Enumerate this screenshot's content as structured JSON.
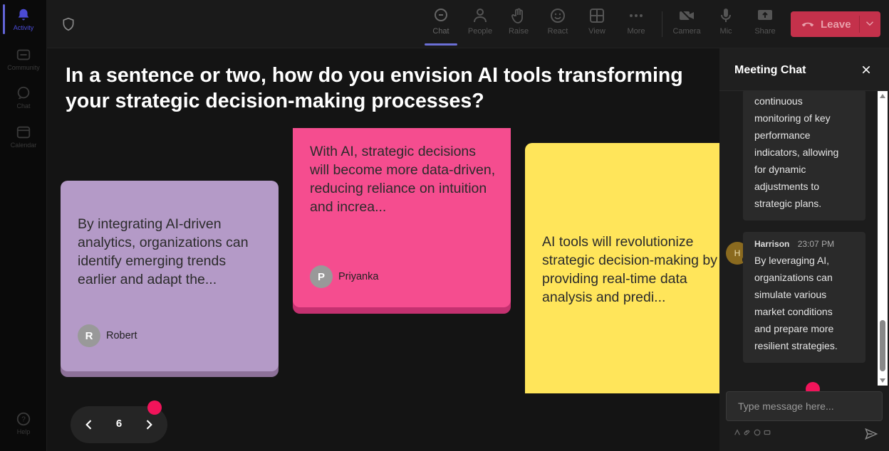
{
  "rail": {
    "items": [
      {
        "label": "Activity",
        "icon": "bell-icon"
      },
      {
        "label": "Community",
        "icon": "community-icon"
      },
      {
        "label": "Chat",
        "icon": "chat-icon"
      },
      {
        "label": "Calendar",
        "icon": "calendar-icon"
      },
      {
        "label": "Help",
        "icon": "help-icon"
      }
    ]
  },
  "toolbar": {
    "chat": "Chat",
    "people": "People",
    "raise": "Raise",
    "react": "React",
    "view": "View",
    "more": "More",
    "camera": "Camera",
    "mic": "Mic",
    "share": "Share",
    "leave": "Leave"
  },
  "stage": {
    "question": "In a sentence or two, how do you envision AI tools transforming your strategic decision-making processes?",
    "cards": [
      {
        "text": "By integrating AI-driven analytics, organizations can identify emerging trends earlier and adapt the...",
        "author": "Robert",
        "initial": "R",
        "color": "#b49ac7"
      },
      {
        "text": "With AI, strategic decisions will become more data-driven, reducing reliance on intuition and increa...",
        "author": "Priyanka",
        "initial": "P",
        "color": "#f54d8f"
      },
      {
        "text": "AI tools will revolutionize strategic decision-making by providing real-time data analysis and predi...",
        "color": "#ffe55a"
      }
    ],
    "page_number": "6"
  },
  "chat": {
    "title": "Meeting Chat",
    "messages": [
      {
        "text_lines": [
          "continuous",
          "monitoring of key",
          "performance",
          "indicators, allowing",
          "for dynamic",
          "adjustments to",
          "strategic plans."
        ]
      },
      {
        "sender": "Harrison",
        "initial": "H",
        "time": "23:07 PM",
        "text_lines": [
          "By leveraging AI,",
          "organizations can",
          "simulate various",
          "market conditions",
          "and prepare more",
          "resilient strategies."
        ]
      }
    ],
    "input_placeholder": "Type message here..."
  },
  "colors": {
    "leave": "#c4314b",
    "accent": "#6264d6",
    "notification_dot": "#f0145a"
  }
}
